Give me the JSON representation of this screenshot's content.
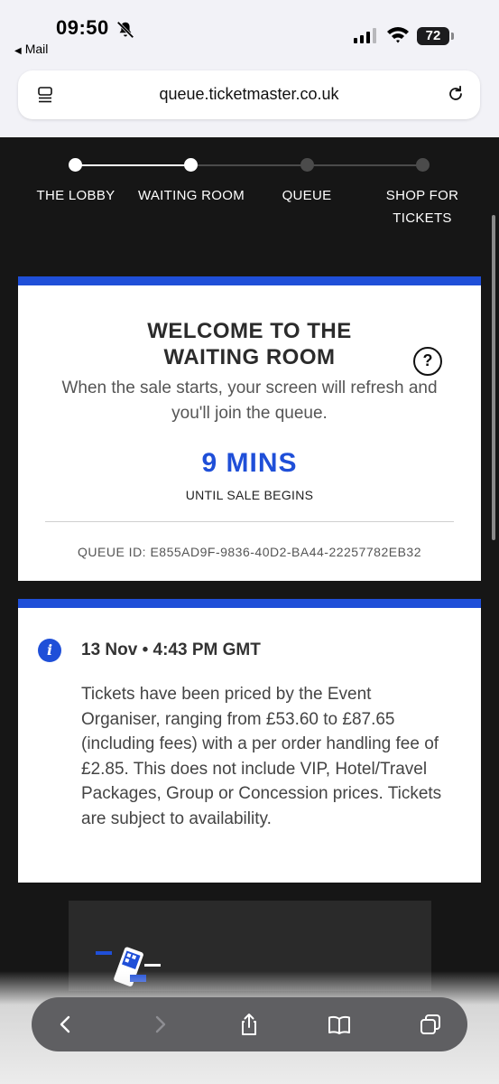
{
  "status_bar": {
    "time": "09:50",
    "back_app": "Mail",
    "battery": "72"
  },
  "browser": {
    "url": "queue.ticketmaster.co.uk"
  },
  "stepper": {
    "steps": [
      {
        "label": "THE LOBBY",
        "state": "done"
      },
      {
        "label": "WAITING ROOM",
        "state": "current"
      },
      {
        "label": "QUEUE",
        "state": "todo"
      },
      {
        "label": "SHOP FOR TICKETS",
        "state": "todo"
      }
    ]
  },
  "waiting_card": {
    "title": "WELCOME TO THE WAITING ROOM",
    "help": "?",
    "intro": "When the sale starts, your screen will refresh and you'll join the queue.",
    "countdown": "9 MINS",
    "countdown_caption": "UNTIL SALE BEGINS",
    "queue_id": "QUEUE ID: E855AD9F-9836-40D2-BA44-22257782EB32"
  },
  "info_card": {
    "icon": "i",
    "date": "13 Nov • 4:43 PM GMT",
    "body": "Tickets have been priced by the Event Organiser, ranging from £53.60 to £87.65 (including fees) with a per order handling fee of £2.85. This does not include VIP, Hotel/Travel Packages, Group or Concession prices. Tickets are subject to availability."
  },
  "colors": {
    "accent": "#1f4fd8",
    "page_bg": "#161616",
    "card_bg": "#ffffff"
  },
  "toolbar_icons": [
    "back-icon",
    "forward-icon",
    "share-icon",
    "bookmarks-icon",
    "tabs-icon"
  ]
}
